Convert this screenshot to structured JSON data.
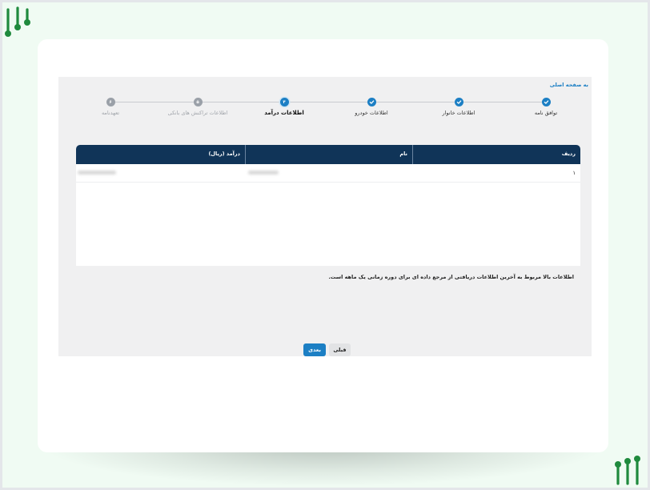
{
  "header": {
    "home_link": "به صفحه اصلی"
  },
  "stepper": {
    "steps": [
      {
        "label": "توافق نامه",
        "number": "۱",
        "status": "done"
      },
      {
        "label": "اطلاعات خانوار",
        "number": "۲",
        "status": "done"
      },
      {
        "label": "اطلاعات خودرو",
        "number": "۳",
        "status": "done"
      },
      {
        "label": "اطلاعات درآمد",
        "number": "۴",
        "status": "active"
      },
      {
        "label": "اطلاعات تراکنش های بانکی",
        "number": "۵",
        "status": "pending"
      },
      {
        "label": "تعهدنامه",
        "number": "۶",
        "status": "pending"
      }
    ]
  },
  "table": {
    "columns": [
      "ردیف",
      "نام",
      "درآمد (ریال)"
    ],
    "rows": [
      {
        "index": "۱",
        "name": "",
        "income": ""
      }
    ]
  },
  "note": "اطلاعات بالا مربوط به آخرین اطلاعات دریافتی از مرجع داده ای برای دوره زمانی یک ماهه است.",
  "buttons": {
    "next": "بعدی",
    "prev": "قبلی"
  },
  "colors": {
    "accent": "#1c7fc4",
    "table_header": "#103458",
    "brand_green": "#1f8a3d"
  },
  "icons": {
    "done": "check-icon",
    "logo": "brand-logo"
  }
}
